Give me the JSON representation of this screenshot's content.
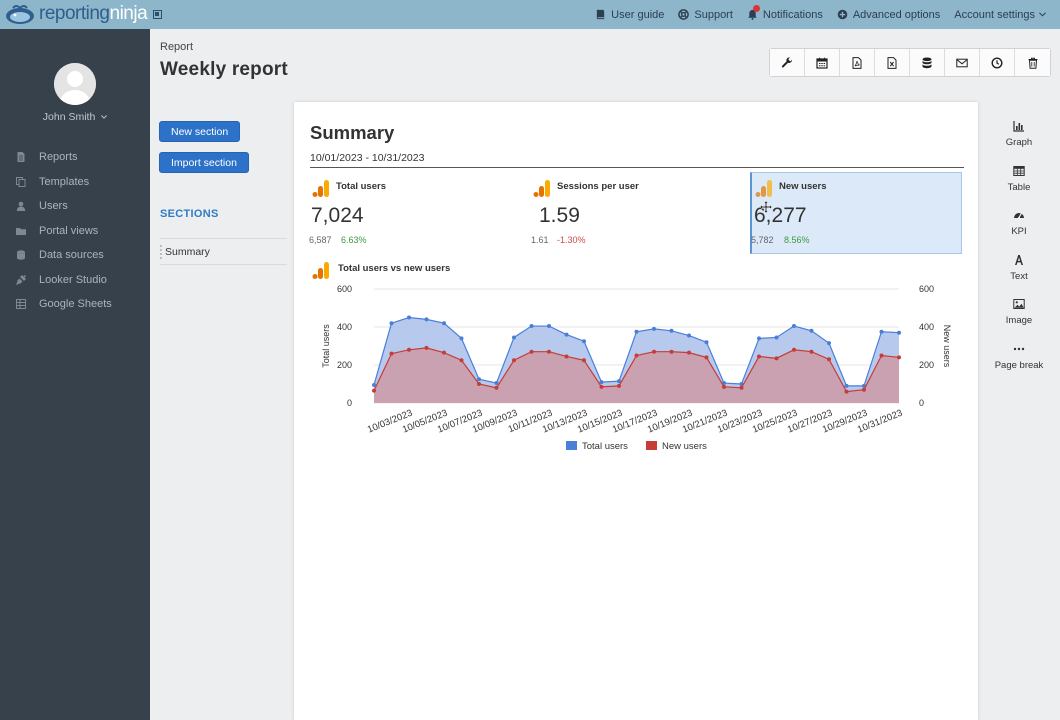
{
  "brand": {
    "logo_part1": "reporting",
    "logo_part2": "ninja"
  },
  "topnav": [
    {
      "label": "User guide",
      "icon": "book-icon"
    },
    {
      "label": "Support",
      "icon": "lifebuoy-icon"
    },
    {
      "label": "Notifications",
      "icon": "bell-icon"
    },
    {
      "label": "Advanced options",
      "icon": "plus-circle-icon"
    },
    {
      "label": "Account settings",
      "icon": "chevron-down-icon"
    }
  ],
  "user": {
    "name": "John Smith"
  },
  "sidebar": {
    "items": [
      {
        "label": "Reports",
        "icon": "file-icon"
      },
      {
        "label": "Templates",
        "icon": "copy-icon"
      },
      {
        "label": "Users",
        "icon": "user-icon"
      },
      {
        "label": "Portal views",
        "icon": "folder-icon"
      },
      {
        "label": "Data sources",
        "icon": "database-icon"
      },
      {
        "label": "Looker Studio",
        "icon": "plug-icon"
      },
      {
        "label": "Google Sheets",
        "icon": "table-icon"
      }
    ]
  },
  "header": {
    "breadcrumb": "Report",
    "title": "Weekly report"
  },
  "toolbar": [
    {
      "icon": "wrench-icon"
    },
    {
      "icon": "calendar-icon"
    },
    {
      "icon": "pdf-file-icon"
    },
    {
      "icon": "excel-file-icon"
    },
    {
      "icon": "database-icon"
    },
    {
      "icon": "envelope-icon"
    },
    {
      "icon": "clock-icon"
    },
    {
      "icon": "trash-icon"
    }
  ],
  "actions": {
    "new_section": "New section",
    "import_section": "Import section"
  },
  "sections": {
    "title": "SECTIONS",
    "items": [
      "Summary"
    ]
  },
  "summary": {
    "title": "Summary",
    "date_range": "10/01/2023 - 10/31/2023",
    "kpis": [
      {
        "label": "Total users",
        "value": "7,024",
        "previous": "6,587",
        "change": "6.63%",
        "direction": "up"
      },
      {
        "label": "Sessions per user",
        "value": "1.59",
        "previous": "1.61",
        "change": "-1.30%",
        "direction": "down"
      },
      {
        "label": "New users",
        "value": "6,277",
        "previous": "5,782",
        "change": "8.56%",
        "direction": "up",
        "selected": true
      }
    ]
  },
  "chart": {
    "title": "Total users vs new users"
  },
  "chart_data": {
    "type": "area",
    "title": "Total users vs new users",
    "xlabel": "",
    "ylabel": "Total users",
    "ylabel_right": "New users",
    "ylim": [
      0,
      600
    ],
    "y_ticks": [
      0,
      200,
      400,
      600
    ],
    "x_tick_labels": [
      "10/03/2023",
      "10/05/2023",
      "10/07/2023",
      "10/09/2023",
      "10/11/2023",
      "10/13/2023",
      "10/15/2023",
      "10/17/2023",
      "10/19/2023",
      "10/21/2023",
      "10/23/2023",
      "10/25/2023",
      "10/27/2023",
      "10/29/2023",
      "10/31/2023"
    ],
    "x": [
      "10/01",
      "10/02",
      "10/03",
      "10/04",
      "10/05",
      "10/06",
      "10/07",
      "10/08",
      "10/09",
      "10/10",
      "10/11",
      "10/12",
      "10/13",
      "10/14",
      "10/15",
      "10/16",
      "10/17",
      "10/18",
      "10/19",
      "10/20",
      "10/21",
      "10/22",
      "10/23",
      "10/24",
      "10/25",
      "10/26",
      "10/27",
      "10/28",
      "10/29",
      "10/30",
      "10/31"
    ],
    "series": [
      {
        "name": "Total users",
        "color": "#4a7fd8",
        "fill": "#aac1eb",
        "values": [
          95,
          420,
          450,
          440,
          420,
          340,
          125,
          105,
          345,
          405,
          405,
          360,
          325,
          110,
          115,
          375,
          390,
          380,
          355,
          320,
          105,
          100,
          340,
          345,
          405,
          380,
          315,
          90,
          90,
          375,
          370
        ]
      },
      {
        "name": "New users",
        "color": "#c63c36",
        "fill": "#cd9aa6",
        "values": [
          65,
          260,
          280,
          290,
          265,
          225,
          100,
          80,
          225,
          270,
          270,
          245,
          225,
          85,
          90,
          250,
          270,
          270,
          265,
          240,
          85,
          80,
          245,
          235,
          280,
          270,
          230,
          60,
          70,
          250,
          240
        ]
      }
    ],
    "legend": "bottom",
    "grid": true
  },
  "palette": [
    {
      "label": "Graph",
      "icon": "bar-chart-icon"
    },
    {
      "label": "Table",
      "icon": "table-icon"
    },
    {
      "label": "KPI",
      "icon": "gauge-icon"
    },
    {
      "label": "Text",
      "icon": "font-icon"
    },
    {
      "label": "Image",
      "icon": "image-icon"
    },
    {
      "label": "Page break",
      "icon": "ellipsis-icon"
    }
  ]
}
